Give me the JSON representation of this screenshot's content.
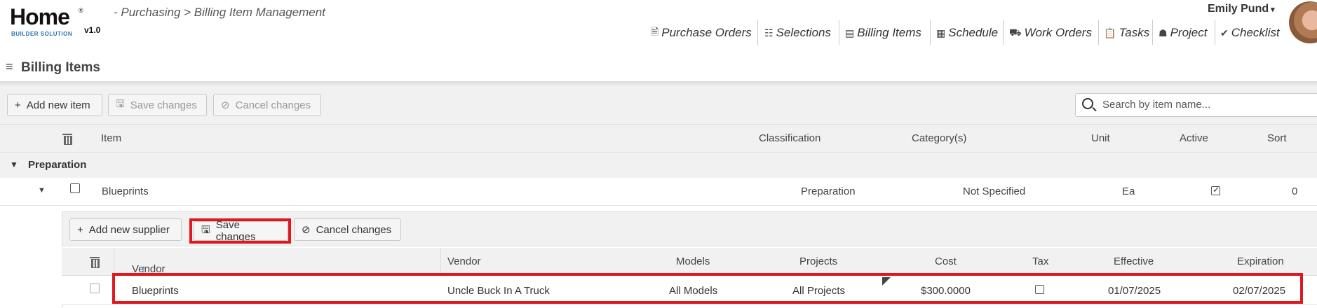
{
  "app": {
    "logo_main": "Home",
    "logo_reg": "®",
    "logo_sub": "BUILDER SOLUTION",
    "version": "v1.0",
    "breadcrumb": "- Purchasing > Billing Item Management"
  },
  "user": {
    "name": "Emily Pund",
    "caret": "▾"
  },
  "nav": [
    {
      "label": "Purchase Orders",
      "icon": "document-icon",
      "glyph": "🗎"
    },
    {
      "label": "Selections",
      "icon": "checklist-icon",
      "glyph": "☷"
    },
    {
      "label": "Billing Items",
      "icon": "list-icon",
      "glyph": "▤"
    },
    {
      "label": "Schedule",
      "icon": "calendar-icon",
      "glyph": "▦"
    },
    {
      "label": "Work Orders",
      "icon": "truck-icon",
      "glyph": "⛟"
    },
    {
      "label": "Tasks",
      "icon": "clipboard-icon",
      "glyph": "📋"
    },
    {
      "label": "Project",
      "icon": "worker-icon",
      "glyph": "☗"
    },
    {
      "label": "Checklist",
      "icon": "check-icon",
      "glyph": "✔"
    }
  ],
  "page": {
    "title": "Billing Items",
    "menu_icon": "≡"
  },
  "toolbar": {
    "add_label": "Add new item",
    "save_label": "Save changes",
    "cancel_label": "Cancel changes",
    "search_placeholder": "Search by item name..."
  },
  "table": {
    "columns": {
      "item": "Item",
      "classification": "Classification",
      "categories": "Category(s)",
      "unit": "Unit",
      "active": "Active",
      "sort": "Sort"
    },
    "group": {
      "label": "Preparation",
      "expanded": true
    },
    "rows": [
      {
        "item": "Blueprints",
        "classification": "Preparation",
        "categories": "Not Specified",
        "unit": "Ea",
        "active": true,
        "sort": "0"
      }
    ]
  },
  "suppliers": {
    "toolbar": {
      "add_label": "Add new supplier",
      "save_label": "Save changes",
      "cancel_label": "Cancel changes"
    },
    "columns": {
      "vendor_item": "Vendor Item",
      "sort_arrow": "↑",
      "vendor": "Vendor",
      "models": "Models",
      "projects": "Projects",
      "cost": "Cost",
      "tax": "Tax",
      "effective": "Effective",
      "expiration": "Expiration"
    },
    "rows": [
      {
        "vendor_item": "Blueprints",
        "vendor": "Uncle Buck In A Truck",
        "models": "All Models",
        "projects": "All Projects",
        "cost": "$300.0000",
        "tax": false,
        "effective": "01/07/2025",
        "expiration": "02/07/2025"
      }
    ]
  },
  "colors": {
    "highlight": "#e0171c",
    "accent": "#2a6fb4"
  }
}
